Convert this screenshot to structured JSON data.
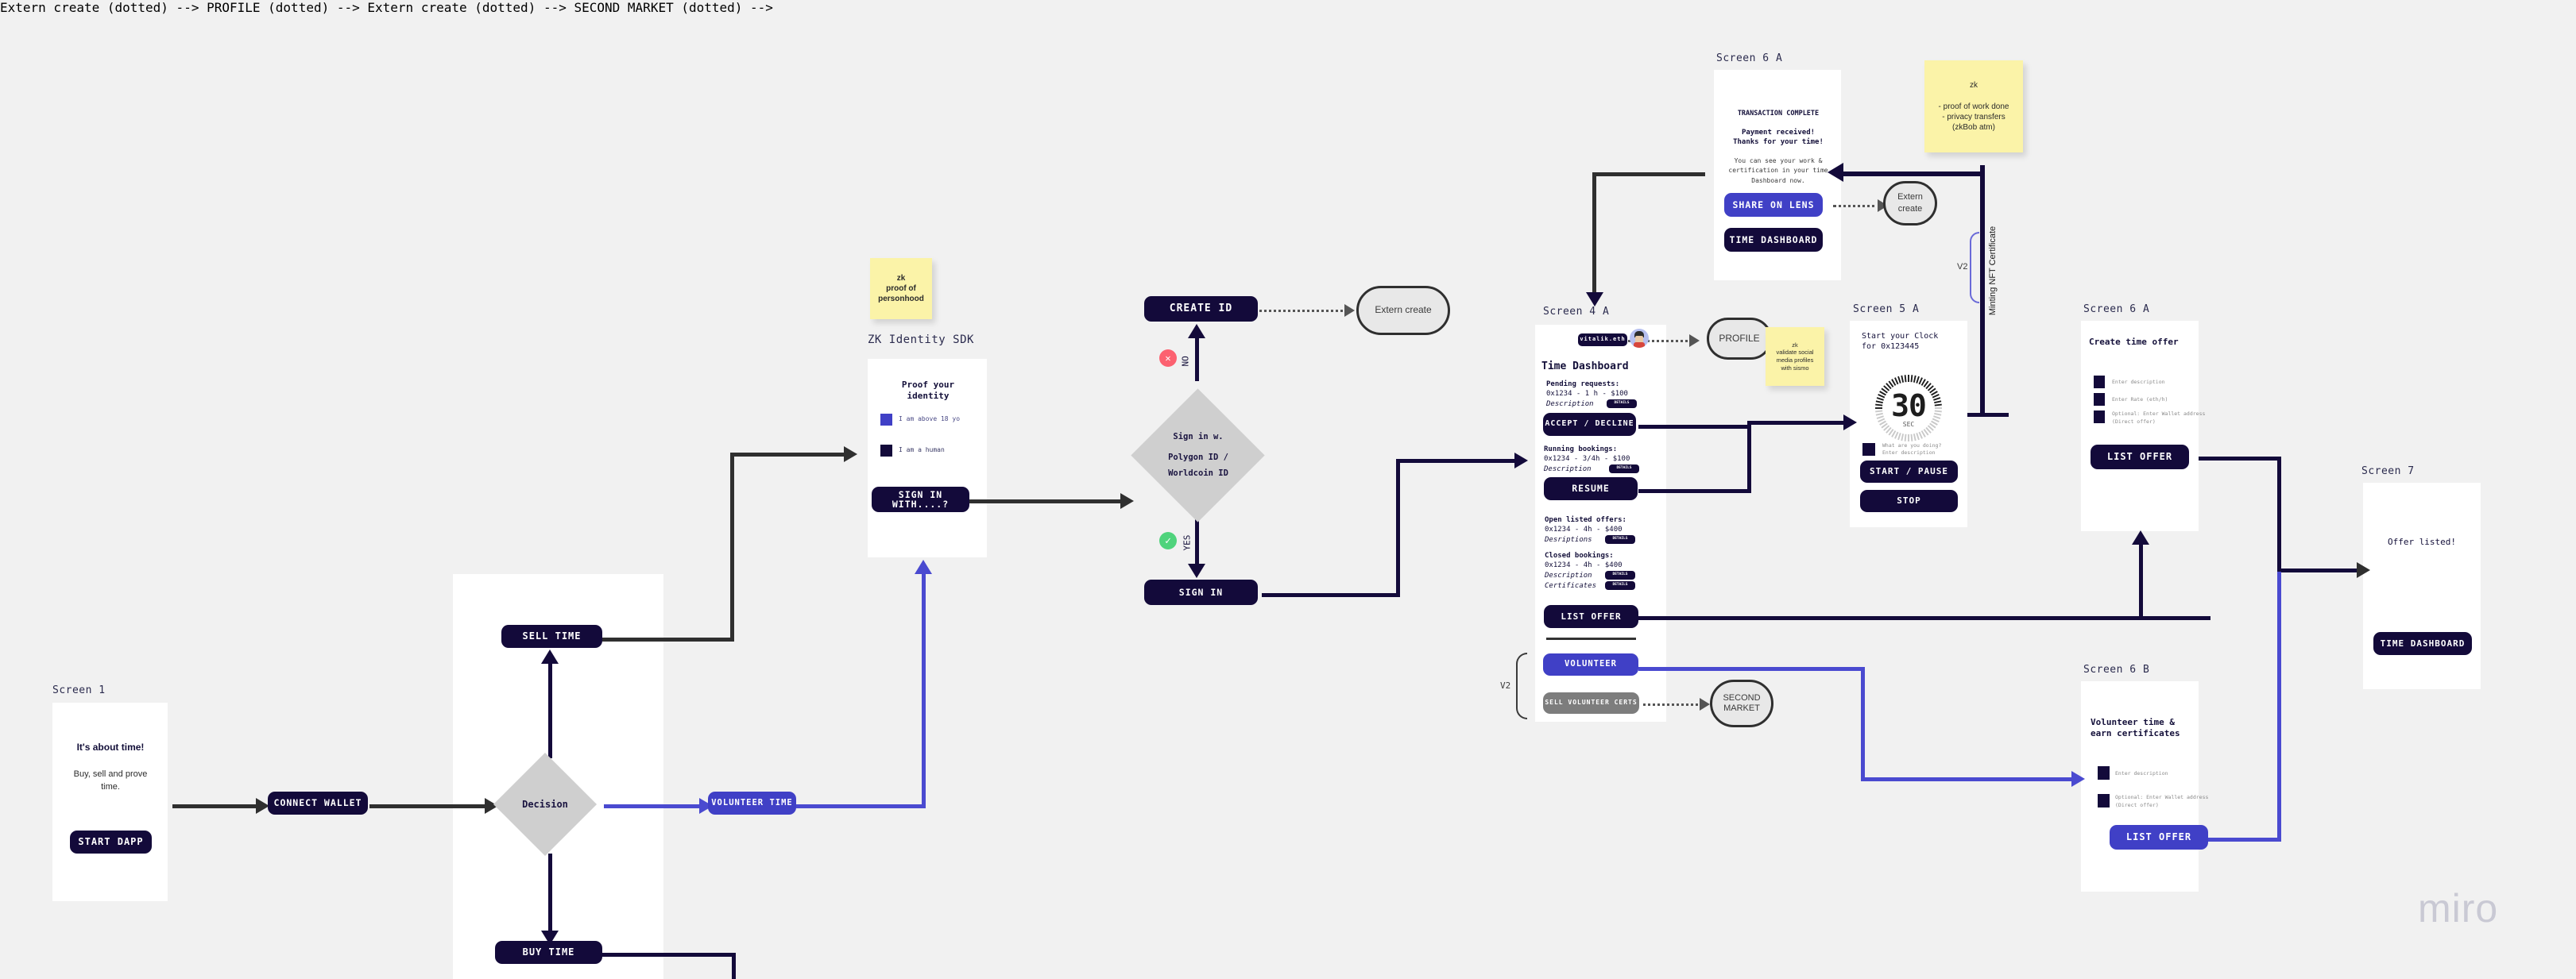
{
  "board": {
    "watermark": "miro",
    "bg_color": "#f1f1f1"
  },
  "palette": {
    "navy": "#130a3a",
    "blue": "#4040c6",
    "grey_button": "#7d7d7d",
    "diamond": "#cfcfcf",
    "sticky": "#fbf3a8",
    "no_badge": "#fc6170",
    "yes_badge": "#4fd37c"
  },
  "screen1": {
    "label": "Screen 1",
    "heading": "It's about time!",
    "subtext": "Buy, sell and prove time.",
    "cta": "START DAPP"
  },
  "connect_wallet": {
    "label": "CONNECT WALLET"
  },
  "decision1": {
    "label": "Decision",
    "branch_sell": "SELL TIME",
    "branch_buy": "BUY TIME",
    "branch_volunteer": "VOLUNTEER TIME"
  },
  "zk_sdk": {
    "title": "ZK Identity SDK",
    "sticky": {
      "line1": "zk",
      "line2": "proof of",
      "line3": "personhood"
    },
    "card_heading": "Proof your identity",
    "checks": [
      {
        "label": "I am above 18 yo",
        "color": "#4040c6"
      },
      {
        "label": "I am a human",
        "color": "#130a3a"
      }
    ],
    "cta": "SIGN IN WITH....?"
  },
  "signin_decision": {
    "line1": "Sign in w.",
    "line2": "Polygon ID /",
    "line3": "Worldcoin ID",
    "no_label": "NO",
    "yes_label": "YES",
    "no_glyph": "✕",
    "yes_glyph": "✓",
    "create_id": "CREATE ID",
    "sign_in": "SIGN IN",
    "extern": "Extern create"
  },
  "screen4a": {
    "label": "Screen 4 A",
    "wallet_chip": "vitalik.eth",
    "avatar_icon": "avatar-icon",
    "title": "Time Dashboard",
    "sections": [
      {
        "heading": "Pending requests:",
        "line": "0x1234 - 1 h - $100",
        "rows": [
          {
            "text": "Description",
            "details": "DETAILS"
          }
        ],
        "cta": "ACCEPT / DECLINE",
        "cta_style": "dark"
      },
      {
        "heading": "Running bookings:",
        "line": "0x1234 -  3/4h - $100",
        "rows": [
          {
            "text": "Description",
            "details": "DETAILS"
          }
        ],
        "cta": "RESUME",
        "cta_style": "dark"
      },
      {
        "heading": "Open listed offers:",
        "line": "0x1234 -  4h - $400",
        "rows": [
          {
            "text": "Desriptions",
            "details": "DETAILS"
          }
        ],
        "cta": null,
        "cta_style": null
      },
      {
        "heading": "Closed bookings:",
        "line": "0x1234 -  4h - $400",
        "rows": [
          {
            "text": "Description",
            "details": "DETAILS"
          },
          {
            "text": "Certificates",
            "details": "DETAILS"
          }
        ],
        "cta": null,
        "cta_style": null
      }
    ],
    "list_offer": "LIST OFFER",
    "v2_label": "V2",
    "volunteer": "VOLUNTEER",
    "sell_volunteer_certs": "SELL VOLUNTEER CERTS",
    "second_market": "SECOND MARKET"
  },
  "profile_node": {
    "label": "PROFILE",
    "sticky": {
      "line1": "zk",
      "line2": "validate social",
      "line3": "media profiles",
      "line4": "with sismo"
    }
  },
  "screen5a": {
    "label": "Screen 5 A",
    "heading_line1": "Start your Clock",
    "heading_line2": "for 0x123445",
    "clock_value": "30",
    "clock_unit": "SEC",
    "field_line1": "What are you doing?",
    "field_line2": "Enter description",
    "btn_start": "START / PAUSE",
    "btn_stop": "STOP"
  },
  "minting": {
    "label": "Minting NFT Certificate",
    "v2": "V2"
  },
  "screen6a_tx": {
    "label": "Screen 6 A",
    "title": "TRANSACTION COMPLETE",
    "sub1": "Payment received!",
    "sub2": "Thanks for your time!",
    "body": "You can see your work & certification in your time Dashboard now.",
    "btn_share": "SHARE ON LENS",
    "btn_dashboard": "TIME DASHBOARD",
    "extern": "Extern create",
    "sticky": {
      "line1": "zk",
      "line2": "- proof of work done",
      "line3": "- privacy transfers",
      "line4": "(zkBob atm)"
    }
  },
  "screen6a_offer": {
    "label": "Screen 6 A",
    "title": "Create time offer",
    "fields": [
      {
        "line1": "Enter description",
        "line2": ""
      },
      {
        "line1": "Enter Rate (eth/h)",
        "line2": ""
      },
      {
        "line1": "Optional: Enter Wallet address",
        "line2": "(Direct offer)"
      }
    ],
    "cta": "LIST OFFER"
  },
  "screen6b": {
    "label": "Screen 6 B",
    "title_line1": "Volunteer time &",
    "title_line2": "earn certificates",
    "fields": [
      {
        "line1": "Enter description",
        "line2": ""
      },
      {
        "line1": "Optional: Enter Wallet address",
        "line2": "(Direct offer)"
      }
    ],
    "cta": "LIST OFFER"
  },
  "screen7": {
    "label": "Screen 7",
    "text": "Offer listed!",
    "cta": "TIME DASHBOARD"
  }
}
